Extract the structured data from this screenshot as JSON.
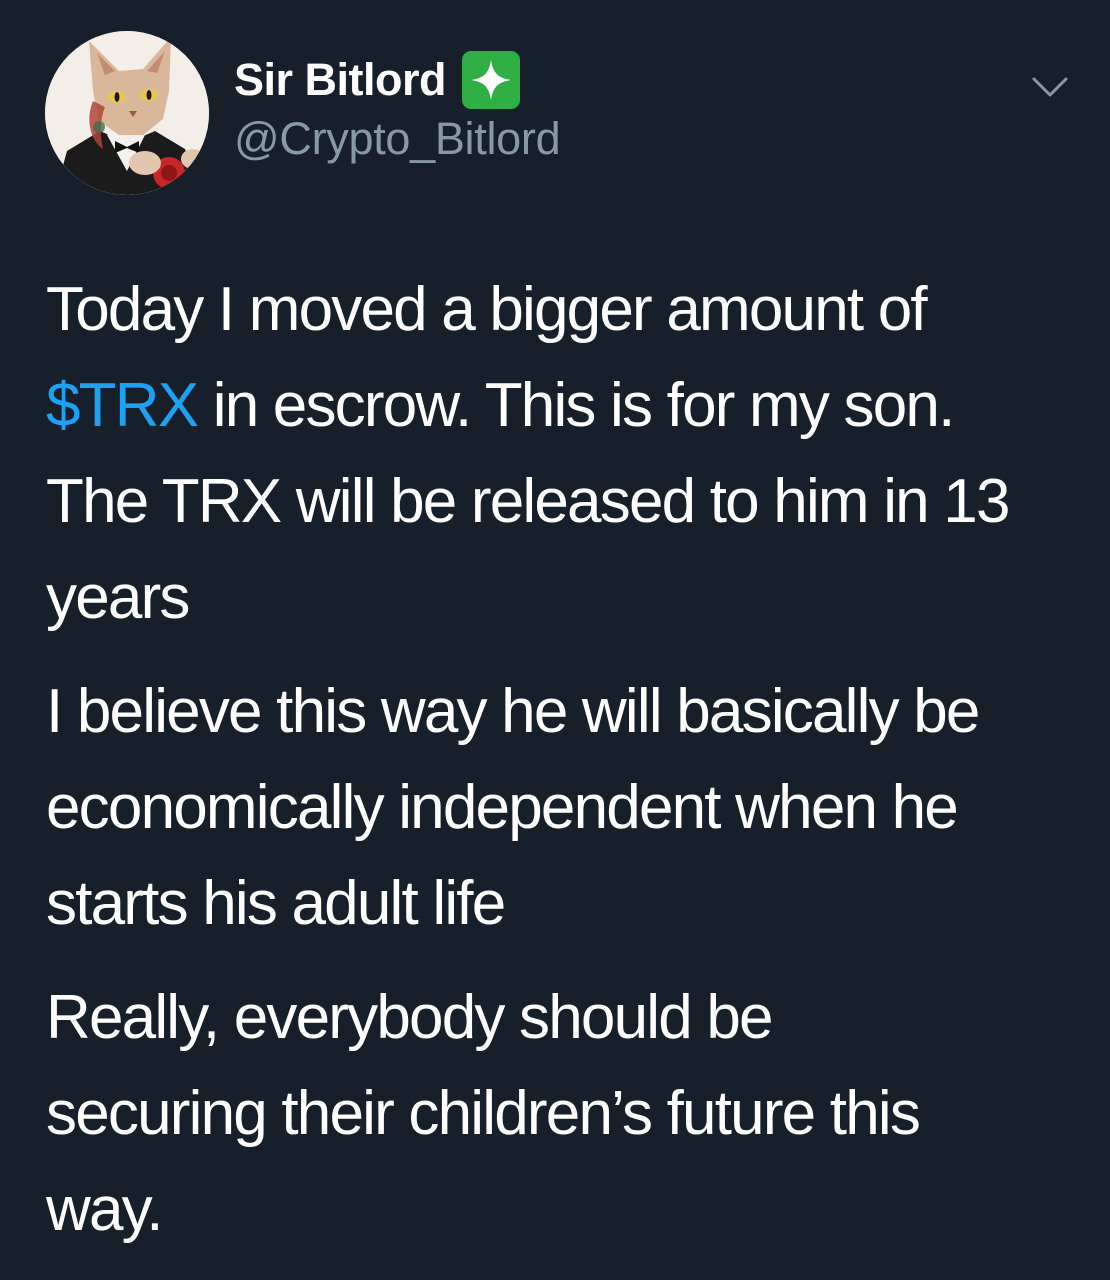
{
  "tweet": {
    "author": {
      "display_name": "Sir Bitlord",
      "handle": "@Crypto_Bitlord",
      "badge_icon": "sparkle-icon",
      "badge_color": "#2fae44",
      "avatar": "cat-in-suit-avatar"
    },
    "menu_icon": "chevron-down-icon",
    "paragraph1": {
      "line1": "Today I moved a bigger amount of",
      "cashtag": "$TRX",
      "rest": " in escrow. This is for my son.",
      "line3": "The TRX will be released to him in 13",
      "line4": "years"
    },
    "paragraph2": {
      "line1": "I believe this way he will basically be",
      "line2": "economically independent when he",
      "line3": "starts his adult life"
    },
    "paragraph3": {
      "line1": "Really, everybody should be",
      "line2": "securing their children’s future this",
      "line3": "way."
    }
  },
  "colors": {
    "background": "#161f2a",
    "text": "#ffffff",
    "secondary": "#8899a6",
    "link": "#1da1f2"
  }
}
